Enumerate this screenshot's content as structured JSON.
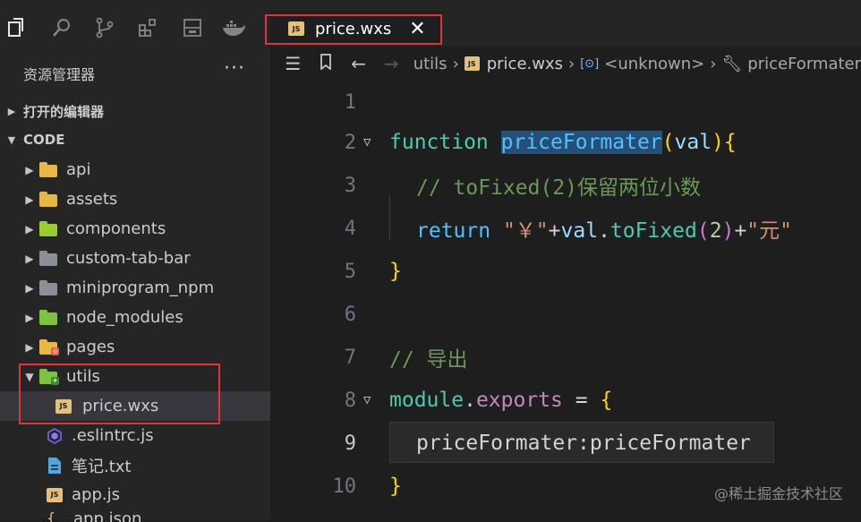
{
  "explorer": {
    "title": "资源管理器",
    "more": "···",
    "open_editors": "打开的编辑器",
    "workspace": "CODE",
    "items": [
      {
        "label": "api",
        "kind": "folder",
        "color": "#e8b844",
        "badge": "⚙"
      },
      {
        "label": "assets",
        "kind": "folder",
        "color": "#e8b844",
        "badge": "▤"
      },
      {
        "label": "components",
        "kind": "folder",
        "color": "#9acd32",
        "badge": "◆"
      },
      {
        "label": "custom-tab-bar",
        "kind": "folder",
        "color": "#8a8f98",
        "badge": ""
      },
      {
        "label": "miniprogram_npm",
        "kind": "folder",
        "color": "#8a8f98",
        "badge": ""
      },
      {
        "label": "node_modules",
        "kind": "folder",
        "color": "#7fc241",
        "badge": "⬢"
      },
      {
        "label": "pages",
        "kind": "folder",
        "color": "#e8b844",
        "badge": "◎"
      },
      {
        "label": "utils",
        "kind": "folder-open",
        "color": "#7fc241",
        "badge": "+"
      },
      {
        "label": "price.wxs",
        "kind": "js",
        "color": "#e5c07b"
      },
      {
        "label": ".eslintrc.js",
        "kind": "eslint",
        "color": "#4b32c3"
      },
      {
        "label": "笔记.txt",
        "kind": "txt",
        "color": "#4fa6e0"
      },
      {
        "label": "app.js",
        "kind": "js",
        "color": "#e5c07b"
      },
      {
        "label": "app.json",
        "kind": "json",
        "color": "#e5c07b"
      }
    ]
  },
  "tab": {
    "label": "price.wxs",
    "badge": "JS",
    "close": "✕"
  },
  "breadcrumbs": {
    "items": [
      "utils",
      "price.wxs",
      "<unknown>",
      "priceFormater"
    ],
    "badge": "JS"
  },
  "editor": {
    "line_numbers": [
      "1",
      "2",
      "3",
      "4",
      "5",
      "6",
      "7",
      "8",
      "9",
      "10"
    ],
    "active_line": "9",
    "l2_kw": "function",
    "l2_fn": "priceFormater",
    "l2_p1": "(",
    "l2_param": "val",
    "l2_p2": ")",
    "l2_b": "{",
    "l3_comment": "// toFixed(2)保留两位小数",
    "l4_kw": "return",
    "l4_str1": "\"￥\"",
    "l4_plus1": "+",
    "l4_val": "val",
    "l4_dot": ".",
    "l4_fn": "toFixed",
    "l4_p1": "(",
    "l4_num": "2",
    "l4_p2": ")",
    "l4_plus2": "+",
    "l4_str2": "\"元\"",
    "l5_b": "}",
    "l7_comment": "// 导出",
    "l8_mod": "module",
    "l8_dot": ".",
    "l8_exp": "exports",
    "l8_eq": " = ",
    "l8_b": "{",
    "l9_key": "priceFormater",
    "l9_colon": ":",
    "l9_val": "priceFormater",
    "l10_b": "}"
  },
  "watermark": "@稀土掘金技术社区",
  "colors": {
    "highlight_box": "#e0343a",
    "background": "#1e1e1e",
    "sidebar": "#252526"
  }
}
